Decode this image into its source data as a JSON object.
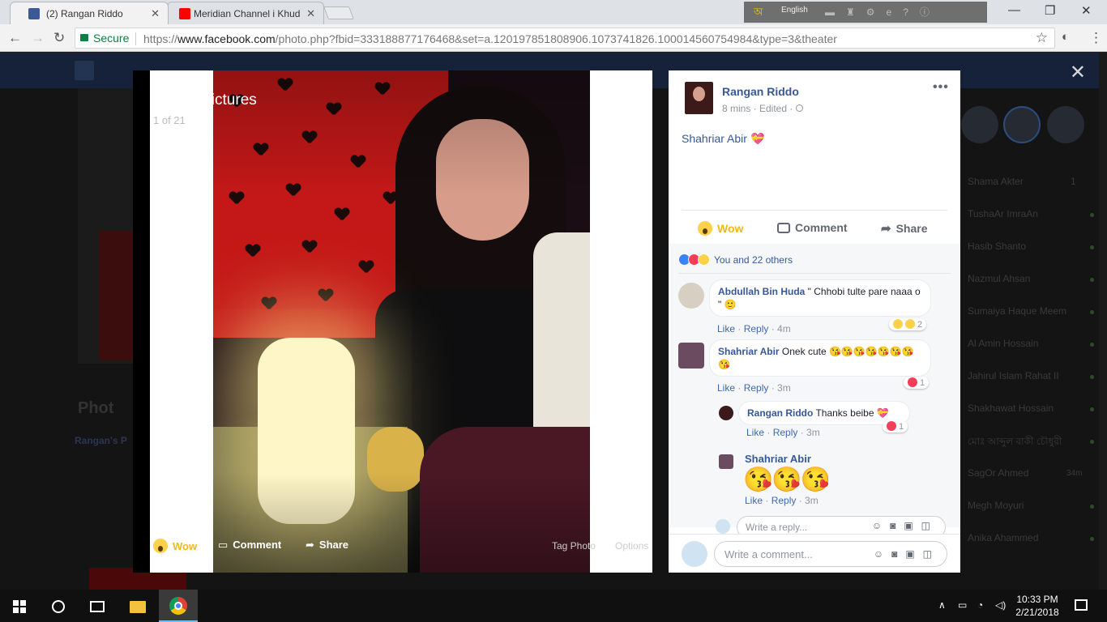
{
  "browser": {
    "tabs": [
      {
        "label": "(2) Rangan Riddo",
        "active": true,
        "favicon": "facebook-favicon",
        "color": "#3b5998"
      },
      {
        "label": "Meridian Channel i Khud",
        "active": false,
        "favicon": "youtube-favicon",
        "color": "#ff0000"
      }
    ],
    "tray_language": "English",
    "secure_label": "Secure",
    "url_prefix": "https://",
    "url_host": "www.facebook.com",
    "url_rest": "/photo.php?fbid=333188877176468&set=a.120197851808906.1073741826.100014560754984&type=3&theater"
  },
  "theater": {
    "album_title": "Profile Pictures",
    "album_count": "1 of 21",
    "actions": {
      "wow": "Wow",
      "comment": "Comment",
      "share": "Share",
      "tag": "Tag Photo",
      "options": "Options"
    }
  },
  "post": {
    "author": "Rangan Riddo",
    "meta": "8 mins · Edited ·",
    "caption": "Shahriar Abir",
    "caption_emoji": "💝",
    "actions": {
      "wow": "Wow",
      "comment": "Comment",
      "share": "Share"
    },
    "reactions_text": "You and 22 others"
  },
  "comments": [
    {
      "author": "Abdullah Bin Huda",
      "text": "\" Chhobi tulte pare naaa o \" 🙂",
      "like": "Like",
      "reply": "Reply",
      "time": "4m",
      "reaction_count": "2"
    },
    {
      "author": "Shahriar Abir",
      "text": "Onek cute 😘😘😘😘😘😘😘😘",
      "like": "Like",
      "reply": "Reply",
      "time": "3m",
      "reaction_count": "1"
    }
  ],
  "replies": [
    {
      "author": "Rangan Riddo",
      "text": "Thanks beibe 💝",
      "like": "Like",
      "reply": "Reply",
      "time": "3m",
      "reaction_count": "1"
    },
    {
      "author": "Shahriar Abir",
      "text": "😘😘😘",
      "like": "Like",
      "reply": "Reply",
      "time": "3m"
    }
  ],
  "reply_placeholder": "Write a reply...",
  "comment_placeholder": "Write a comment...",
  "background_chat": [
    "Shama Akter",
    "TushaAr ImraAn",
    "Hasib Shanto",
    "Nazmul Ahsan",
    "Sumaiya Haque Meem",
    "Al Amin Hossain",
    "Jahirul Islam Rahat II",
    "Shakhawat Hossain",
    "মোঃ আব্দুল বাকী চৌধুরী",
    "SagOr Ahmed",
    "Megh Moyuri",
    "Anika Ahammed"
  ],
  "background_chat_badge": "1",
  "background_sogor_time": "34m",
  "background_section_label": "Phot",
  "background_album_link": "Rangan's P",
  "taskbar": {
    "time": "10:33 PM",
    "date": "2/21/2018"
  },
  "colors": {
    "fb_blue": "#365899",
    "link": "#4267b2",
    "wow": "#f0ba15",
    "secure": "#0b8043"
  }
}
